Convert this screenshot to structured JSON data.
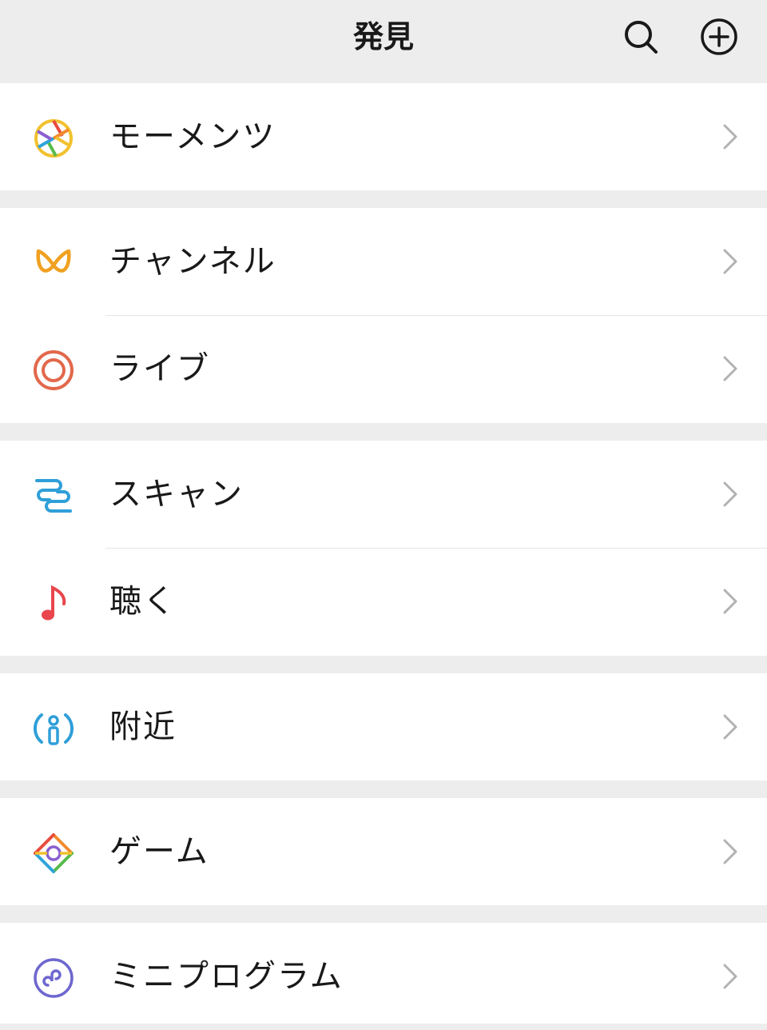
{
  "header": {
    "title": "発見",
    "search_icon": "search-icon",
    "add_icon": "plus-circle-icon"
  },
  "menu": [
    {
      "label": "モーメンツ",
      "icon": "moments-aperture-icon"
    },
    {
      "label": "チャンネル",
      "icon": "channels-butterfly-icon",
      "color": "#f0a020"
    },
    {
      "label": "ライブ",
      "icon": "live-rings-icon",
      "color": "#e2684b"
    },
    {
      "label": "スキャン",
      "icon": "scan-icon",
      "color": "#2f9fd8"
    },
    {
      "label": "聴く",
      "icon": "music-note-icon",
      "color": "#e8464c"
    },
    {
      "label": "附近",
      "icon": "nearby-person-icon",
      "color": "#2f9fd8"
    },
    {
      "label": "ゲーム",
      "icon": "game-diamond-icon"
    },
    {
      "label": "ミニプログラム",
      "icon": "mini-program-icon",
      "color": "#6e67cf"
    }
  ],
  "chevron_icon": "chevron-right-icon"
}
